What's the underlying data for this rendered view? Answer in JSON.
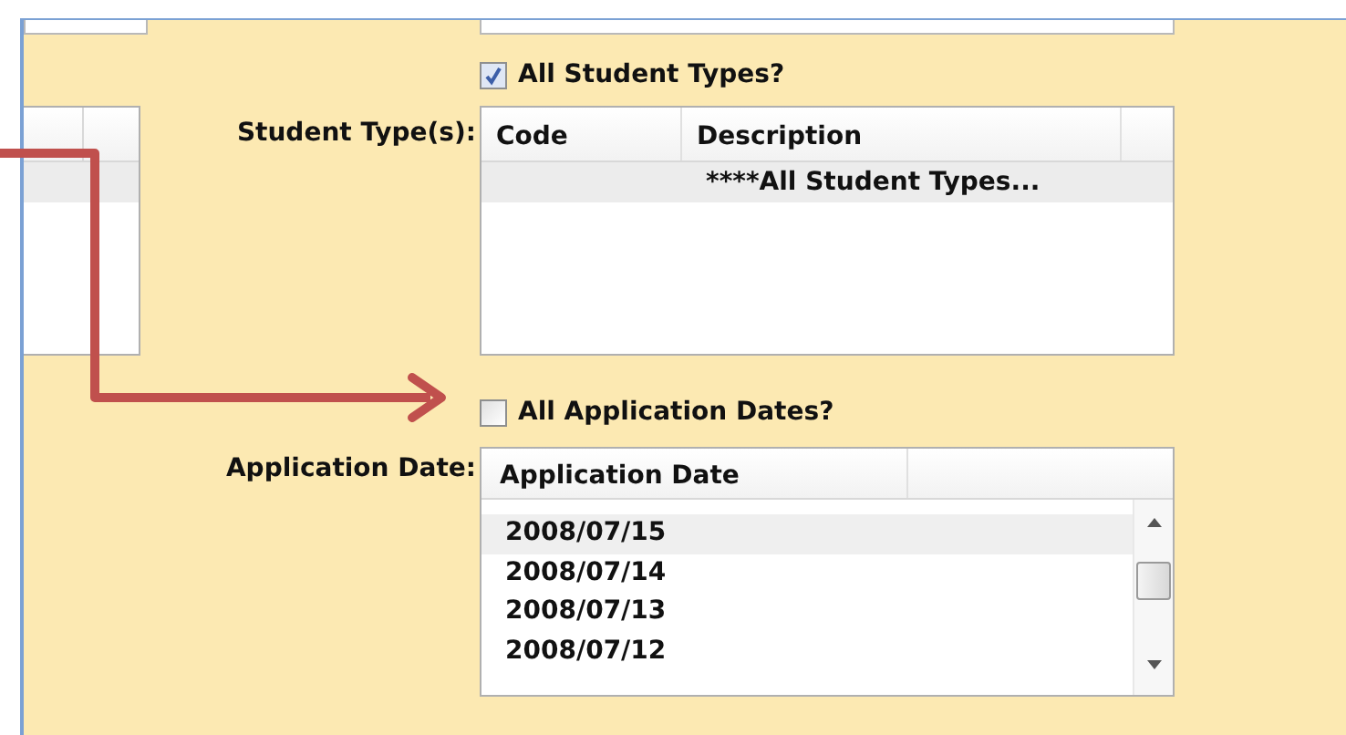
{
  "student_types_toggle": {
    "label": "All Student Types?",
    "checked": true
  },
  "student_types": {
    "label": "Student Type(s):",
    "columns": [
      "Code",
      "Description"
    ],
    "rows": [
      {
        "description": "****All Student Types...",
        "selected": true
      }
    ]
  },
  "application_dates_toggle": {
    "label": "All Application Dates?",
    "checked": false
  },
  "application_dates": {
    "label": "Application Date:",
    "columns": [
      "Application Date"
    ],
    "rows": [
      {
        "date": "2008/07/15",
        "selected": true
      },
      {
        "date": "2008/07/14",
        "selected": false
      },
      {
        "date": "2008/07/13",
        "selected": false
      },
      {
        "date": "2008/07/12",
        "selected": false
      }
    ]
  }
}
